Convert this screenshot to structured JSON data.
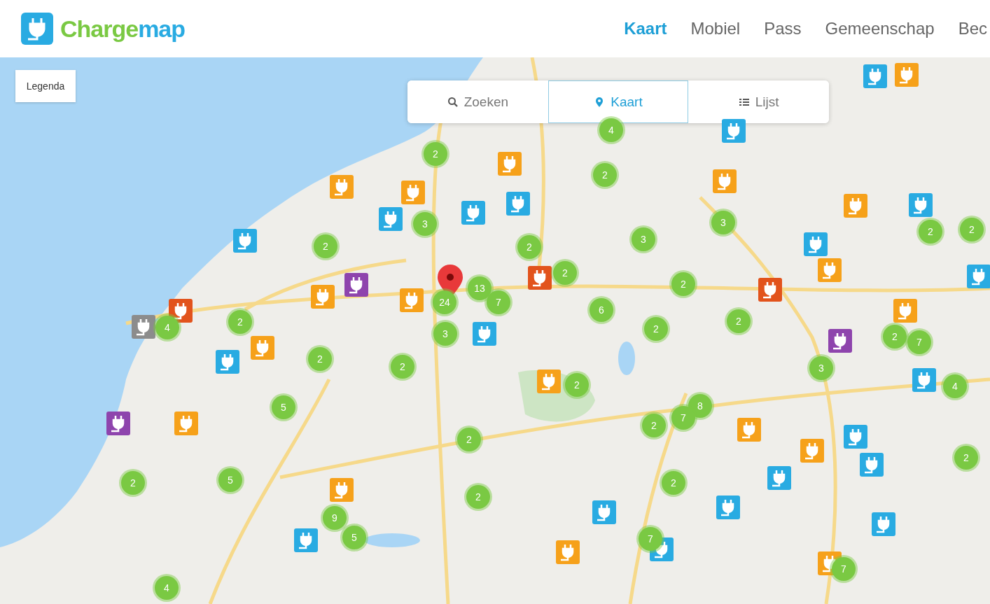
{
  "logo": {
    "part_1": "Charge",
    "part_2": "map"
  },
  "nav": [
    {
      "label": "Kaart",
      "selected": true
    },
    {
      "label": "Mobiel",
      "selected": false
    },
    {
      "label": "Pass",
      "selected": false
    },
    {
      "label": "Gemeenschap",
      "selected": false
    },
    {
      "label": "Bec",
      "selected": false
    }
  ],
  "legend_button": "Legenda",
  "view_tabs": [
    {
      "kind": "search",
      "label": "Zoeken",
      "selected": false
    },
    {
      "kind": "map",
      "label": "Kaart",
      "selected": true
    },
    {
      "kind": "list",
      "label": "Lijst",
      "selected": false
    }
  ],
  "clusters": [
    {
      "count": "2"
    },
    {
      "count": "4"
    },
    {
      "count": "2"
    },
    {
      "count": "3"
    },
    {
      "count": "3"
    },
    {
      "count": "2"
    },
    {
      "count": "2"
    },
    {
      "count": "3"
    },
    {
      "count": "2"
    },
    {
      "count": "2"
    },
    {
      "count": "2"
    },
    {
      "count": "2"
    },
    {
      "count": "13"
    },
    {
      "count": "24"
    },
    {
      "count": "7"
    },
    {
      "count": "6"
    },
    {
      "count": "4"
    },
    {
      "count": "2"
    },
    {
      "count": "3"
    },
    {
      "count": "2"
    },
    {
      "count": "2"
    },
    {
      "count": "2"
    },
    {
      "count": "7"
    },
    {
      "count": "2"
    },
    {
      "count": "2"
    },
    {
      "count": "3"
    },
    {
      "count": "2"
    },
    {
      "count": "4"
    },
    {
      "count": "5"
    },
    {
      "count": "8"
    },
    {
      "count": "7"
    },
    {
      "count": "2"
    },
    {
      "count": "2"
    },
    {
      "count": "2"
    },
    {
      "count": "2"
    },
    {
      "count": "5"
    },
    {
      "count": "2"
    },
    {
      "count": "2"
    },
    {
      "count": "9"
    },
    {
      "count": "5"
    },
    {
      "count": "7"
    },
    {
      "count": "7"
    },
    {
      "count": "4"
    }
  ],
  "pins": [
    {
      "color": "#29abe2"
    },
    {
      "color": "#f6a11a"
    },
    {
      "color": "#29abe2"
    },
    {
      "color": "#f6a11a"
    },
    {
      "color": "#f6a11a"
    },
    {
      "color": "#f6a11a"
    },
    {
      "color": "#f6a11a"
    },
    {
      "color": "#29abe2"
    },
    {
      "color": "#29abe2"
    },
    {
      "color": "#29abe2"
    },
    {
      "color": "#29abe2"
    },
    {
      "color": "#29abe2"
    },
    {
      "color": "#f6a11a"
    },
    {
      "color": "#29abe2"
    },
    {
      "color": "#f6a11a"
    },
    {
      "color": "#8e44ad"
    },
    {
      "color": "#f6a11a"
    },
    {
      "color": "#f6a11a"
    },
    {
      "color": "#e2531c"
    },
    {
      "color": "#e2531c"
    },
    {
      "color": "#e2531c"
    },
    {
      "color": "#8c8c8c"
    },
    {
      "color": "#f6a11a"
    },
    {
      "color": "#8e44ad"
    },
    {
      "color": "#f6a11a"
    },
    {
      "color": "#29abe2"
    },
    {
      "color": "#29abe2"
    },
    {
      "color": "#29abe2"
    },
    {
      "color": "#f6a11a"
    },
    {
      "color": "#29abe2"
    },
    {
      "color": "#8e44ad"
    },
    {
      "color": "#f6a11a"
    },
    {
      "color": "#f6a11a"
    },
    {
      "color": "#29abe2"
    },
    {
      "color": "#f6a11a"
    },
    {
      "color": "#29abe2"
    },
    {
      "color": "#29abe2"
    },
    {
      "color": "#f6a11a"
    },
    {
      "color": "#29abe2"
    },
    {
      "color": "#29abe2"
    },
    {
      "color": "#29abe2"
    },
    {
      "color": "#f6a11a"
    },
    {
      "color": "#29abe2"
    },
    {
      "color": "#29abe2"
    },
    {
      "color": "#f6a11a"
    }
  ]
}
